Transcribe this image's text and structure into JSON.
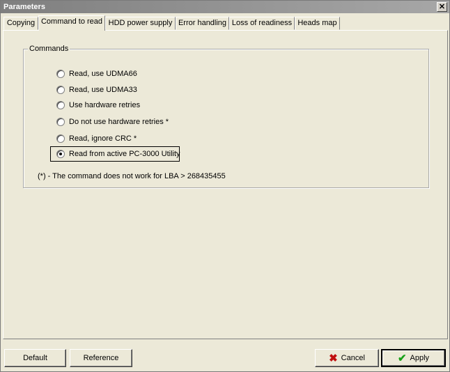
{
  "window": {
    "title": "Parameters",
    "close_symbol": "✕"
  },
  "tabs": [
    {
      "label": "Copying",
      "active": false
    },
    {
      "label": "Command to read",
      "active": true
    },
    {
      "label": "HDD power supply",
      "active": false
    },
    {
      "label": "Error handling",
      "active": false
    },
    {
      "label": "Loss of readiness",
      "active": false
    },
    {
      "label": "Heads map",
      "active": false
    }
  ],
  "commands": {
    "group_label": "Commands",
    "options": [
      {
        "label": "Read, use UDMA66",
        "checked": false
      },
      {
        "label": "Read, use UDMA33",
        "checked": false
      },
      {
        "label": "Use hardware retries",
        "checked": false
      },
      {
        "label": "Do not use hardware retries *",
        "checked": false
      },
      {
        "label": "Read, ignore CRC *",
        "checked": false
      },
      {
        "label": "Read from active PC-3000 Utility",
        "checked": true
      }
    ],
    "note": "(*) - The command does not work for LBA > 268435455"
  },
  "buttons": {
    "default_label": "Default",
    "reference_label": "Reference",
    "cancel_label": "Cancel",
    "apply_label": "Apply",
    "cancel_icon": "x-icon",
    "apply_icon": "check-icon"
  }
}
